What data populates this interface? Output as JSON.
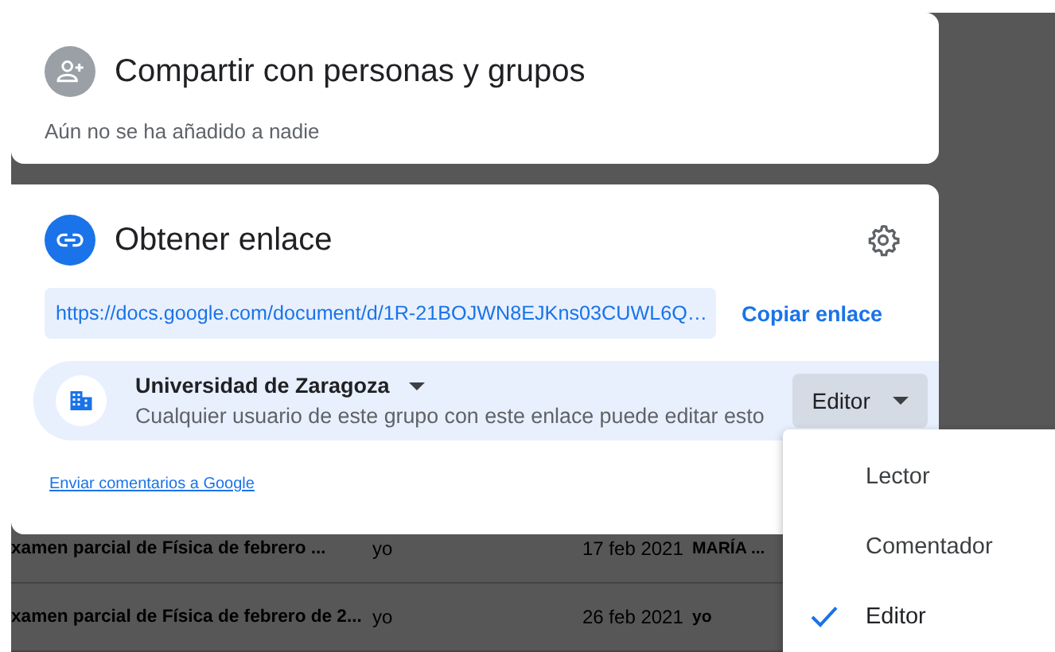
{
  "share_people": {
    "title": "Compartir con personas y grupos",
    "subtitle": "Aún no se ha añadido a nadie"
  },
  "get_link": {
    "title": "Obtener enlace",
    "url": "https://docs.google.com/document/d/1R-21BOJWN8EJKns03CUWL6Q…",
    "copy_label": "Copiar enlace",
    "access": {
      "group": "Universidad de Zaragoza",
      "description": "Cualquier usuario de este grupo con este enlace puede editar esto",
      "role": "Editor"
    },
    "feedback_link": "Enviar comentarios a Google"
  },
  "background_rows": [
    {
      "name": "xamen parcial de Física de febrero ...",
      "owner": "yo",
      "date": "17 feb 2021",
      "modified_by": "MARÍA ..."
    },
    {
      "name": "xamen parcial de Física de febrero de 2...",
      "owner": "yo",
      "date": "26 feb 2021",
      "modified_by": "yo"
    }
  ],
  "role_menu": [
    {
      "label": "Lector",
      "selected": false
    },
    {
      "label": "Comentador",
      "selected": false
    },
    {
      "label": "Editor",
      "selected": true
    }
  ]
}
